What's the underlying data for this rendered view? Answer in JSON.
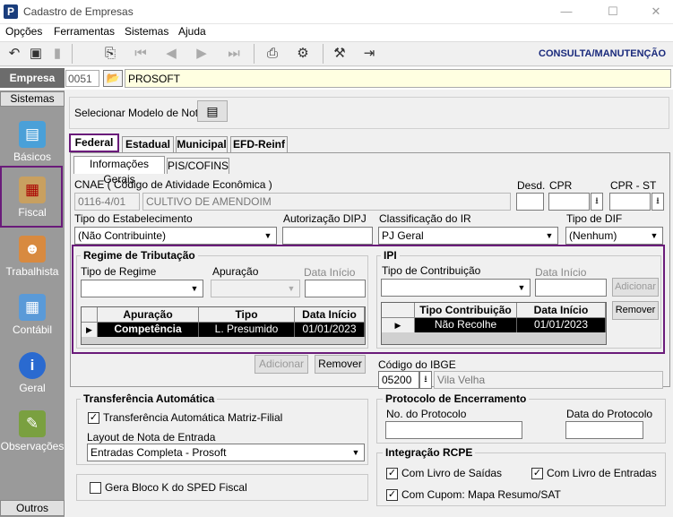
{
  "window": {
    "title": "Cadastro de Empresas",
    "minimize": "—",
    "maximize": "☐",
    "close": "✕"
  },
  "menu": [
    "Opções",
    "Ferramentas",
    "Sistemas",
    "Ajuda"
  ],
  "toolbar": {
    "mode_label": "CONSULTA/MANUTENÇÃO"
  },
  "empresa": {
    "label": "Empresa",
    "code": "0051",
    "name": "PROSOFT"
  },
  "sidebar": {
    "header": "Sistemas",
    "footer": "Outros",
    "items": [
      {
        "label": "Básicos",
        "icon": "notebook-icon"
      },
      {
        "label": "Fiscal",
        "icon": "stamp-icon"
      },
      {
        "label": "Trabalhista",
        "icon": "worker-icon"
      },
      {
        "label": "Contábil",
        "icon": "calculator-icon"
      },
      {
        "label": "Geral",
        "icon": "info-icon"
      },
      {
        "label": "Observações",
        "icon": "pencil-note-icon"
      }
    ]
  },
  "modelo": {
    "label": "Selecionar Modelo de Nota"
  },
  "tabs": [
    "Federal",
    "Estadual",
    "Municipal",
    "EFD-Reinf"
  ],
  "subtabs": [
    "Informações Gerais",
    "PIS/COFINS"
  ],
  "cnae": {
    "label": "CNAE ( Código de  Atividade Econômica )",
    "code": "0116-4/01",
    "desc": "CULTIVO DE AMENDOIM"
  },
  "desd": {
    "label": "Desd.",
    "value": ""
  },
  "cpr": {
    "label": "CPR",
    "value": ""
  },
  "cpr_st": {
    "label": "CPR - ST",
    "value": ""
  },
  "tipo_estab": {
    "label": "Tipo do Estabelecimento",
    "value": "(Não Contribuinte)"
  },
  "aut_dipj": {
    "label": "Autorização DIPJ",
    "value": ""
  },
  "class_ir": {
    "label": "Classificação do IR",
    "value": "PJ Geral"
  },
  "tipo_dif": {
    "label": "Tipo de DIF",
    "value": "(Nenhum)"
  },
  "regime": {
    "title": "Regime de Tributação",
    "tipo_label": "Tipo de Regime",
    "apuracao_label": "Apuração",
    "data_label": "Data Início",
    "columns": [
      "Apuração",
      "Tipo",
      "Data Início"
    ],
    "rows": [
      {
        "apuracao": "Competência",
        "tipo": "L. Presumido",
        "data": "01/01/2023"
      }
    ],
    "add": "Adicionar",
    "remove": "Remover"
  },
  "ipi": {
    "title": "IPI",
    "tipo_label": "Tipo de Contribuição",
    "data_label": "Data Início",
    "columns": [
      "Tipo Contribuição",
      "Data Início"
    ],
    "rows": [
      {
        "tipo": "Não Recolhe",
        "data": "01/01/2023"
      }
    ],
    "add": "Adicionar",
    "remove": "Remover"
  },
  "ibge": {
    "label": "Código do IBGE",
    "code": "05200",
    "city": "Vila Velha"
  },
  "transf": {
    "title": "Transferência Automática",
    "check_label": "Transferência Automática Matriz-Filial",
    "checked": true,
    "layout_label": "Layout de Nota de Entrada",
    "layout_value": "Entradas Completa - Prosoft"
  },
  "bloco_k": {
    "label": "Gera Bloco K do SPED Fiscal",
    "checked": false
  },
  "protocolo": {
    "title": "Protocolo de Encerramento",
    "num_label": "No. do Protocolo",
    "data_label": "Data do Protocolo",
    "num_value": "",
    "data_value": ""
  },
  "rcpe": {
    "title": "Integração RCPE",
    "saidas": "Com Livro de Saídas",
    "entradas": "Com Livro de Entradas",
    "cupom": "Com Cupom: Mapa Resumo/SAT"
  }
}
